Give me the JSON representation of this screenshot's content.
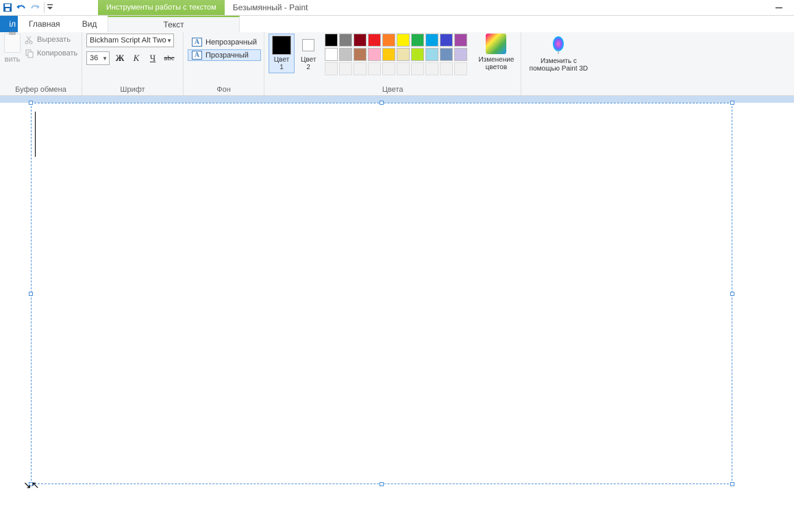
{
  "title": "Безымянный - Paint",
  "context_tab": "Инструменты работы с текстом",
  "tabs": {
    "file": "іл",
    "home": "Главная",
    "view": "Вид",
    "text": "Текст"
  },
  "clipboard": {
    "paste": "вить",
    "cut": "Вырезать",
    "copy": "Копировать",
    "group_label": "Буфер обмена"
  },
  "font": {
    "family": "Bickham Script Alt Two",
    "size": "36",
    "bold": "Ж",
    "italic": "К",
    "underline": "Ч",
    "strike": "abc",
    "group_label": "Шрифт"
  },
  "background": {
    "opaque": "Непрозрачный",
    "transparent": "Прозрачный",
    "group_label": "Фон"
  },
  "colors": {
    "color1_label": "Цвет\n1",
    "color2_label": "Цвет\n2",
    "edit_label": "Изменение\nцветов",
    "group_label": "Цвета",
    "color1_value": "#000000",
    "color2_value": "#ffffff",
    "row1": [
      "#000000",
      "#7f7f7f",
      "#880015",
      "#ed1c24",
      "#ff7f27",
      "#fff200",
      "#22b14c",
      "#00a2e8",
      "#3f48cc",
      "#a349a4"
    ],
    "row2": [
      "#ffffff",
      "#c3c3c3",
      "#b97a57",
      "#ffaec9",
      "#ffc90e",
      "#efe4b0",
      "#b5e61d",
      "#99d9ea",
      "#7092be",
      "#c8bfe7"
    ]
  },
  "paint3d": {
    "label": "Изменить с\nпомощью Paint 3D"
  }
}
